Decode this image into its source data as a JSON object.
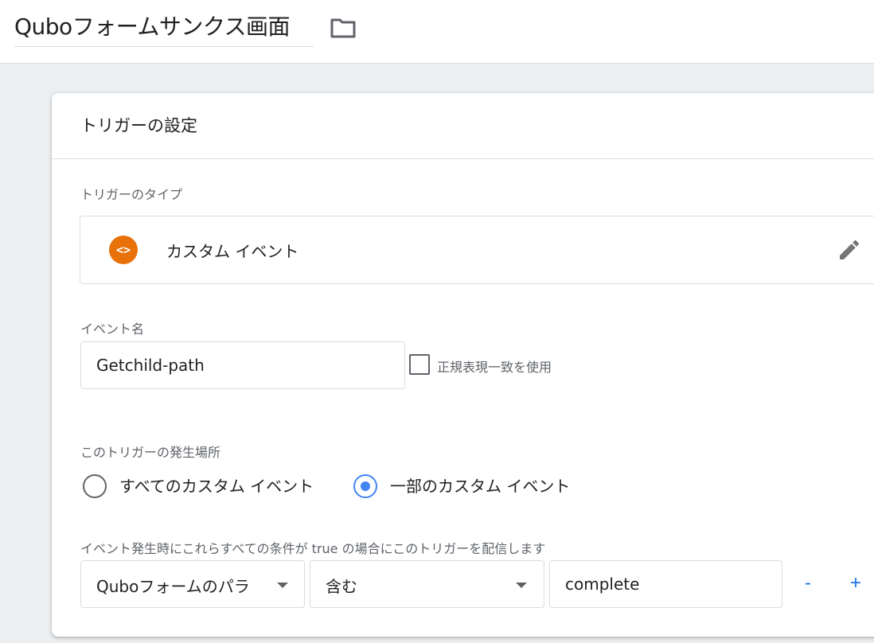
{
  "header": {
    "title": "Quboフォームサンクス画面"
  },
  "trigger_config": {
    "title": "トリガーの設定",
    "type_label": "トリガーのタイプ",
    "type_value": "カスタム イベント",
    "event_name_label": "イベント名",
    "event_name_value": "Getchild-path",
    "regex_checkbox_label": "正規表現一致を使用",
    "regex_checked": false,
    "fire_on_label": "このトリガーの発生場所",
    "fire_on_options": [
      {
        "label": "すべてのカスタム イベント",
        "selected": false
      },
      {
        "label": "一部のカスタム イベント",
        "selected": true
      }
    ],
    "condition_label": "イベント発生時にこれらすべての条件が true の場合にこのトリガーを配信します",
    "condition": {
      "variable": "Quboフォームのパラ",
      "operator": "含む",
      "value": "complete"
    },
    "remove_label": "-",
    "add_label": "+"
  },
  "colors": {
    "accent": "#4285f4",
    "button_blue": "#1a73e8",
    "trigger_icon": "#e8710a"
  },
  "icons": {
    "folder": "folder-icon",
    "trigger_type": "custom-event-icon",
    "edit": "pencil-icon"
  }
}
